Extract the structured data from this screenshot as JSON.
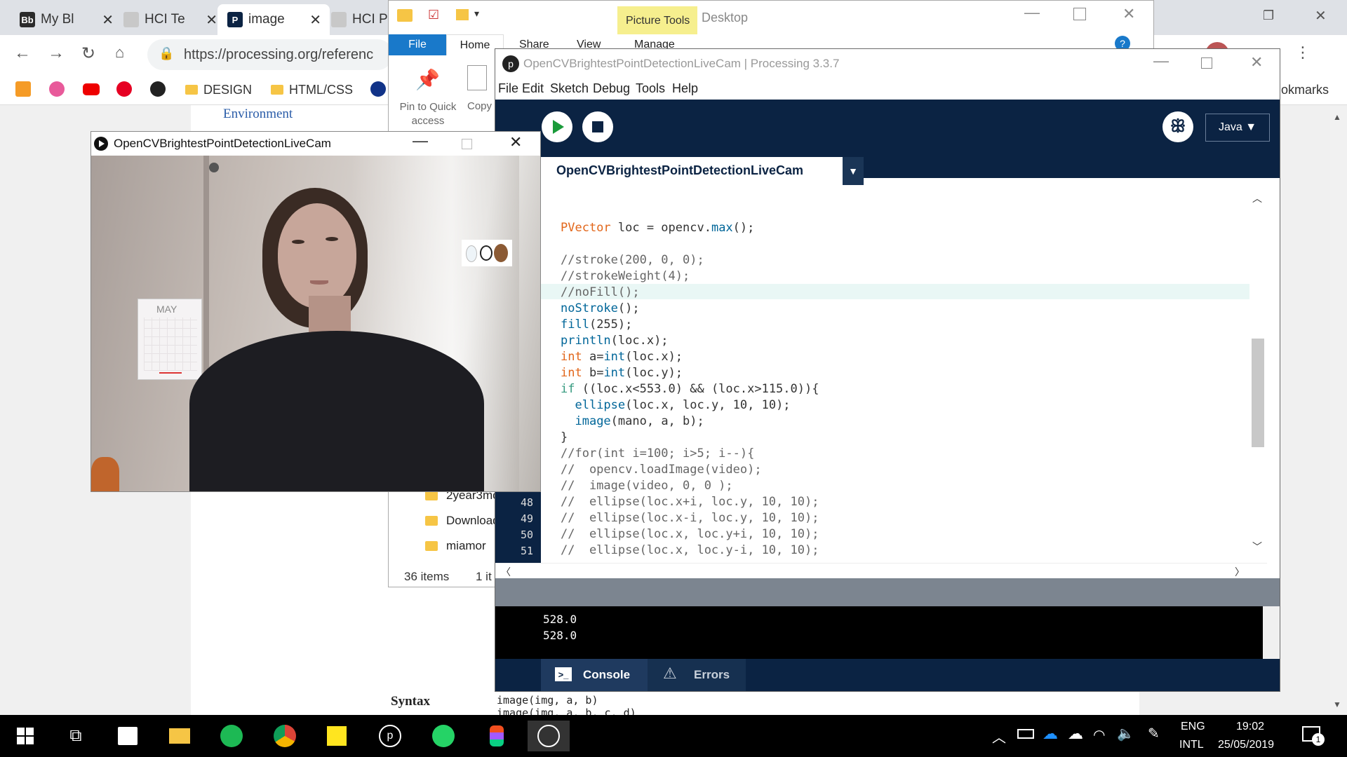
{
  "chrome": {
    "tabs": [
      {
        "label": "My Bl",
        "favicon": "Bb"
      },
      {
        "label": "HCI Te",
        "favicon": ""
      },
      {
        "label": "image",
        "favicon": "P"
      },
      {
        "label": "HCI P",
        "favicon": ""
      }
    ],
    "url": "https://processing.org/referenc",
    "bookmarks": [
      "DESIGN",
      "HTML/CSS"
    ],
    "bookmarks_right": "okmarks"
  },
  "page": {
    "environment_link": "Environment",
    "syntax_label": "Syntax",
    "syntax_lines": [
      "image(img, a, b)",
      "image(img, a, b, c, d)"
    ]
  },
  "explorer": {
    "tab_file": "File",
    "tab_home": "Home",
    "tab_share": "Share",
    "tab_view": "View",
    "tab_manage": "Manage",
    "picture_tools": "Picture Tools",
    "title": "Desktop",
    "pin_label": "Pin to Quick access",
    "copy_label": "Copy",
    "items": [
      "2year3mo",
      "Download",
      "miamor"
    ],
    "status_items": "36 items",
    "status_selected": "1 it"
  },
  "processing": {
    "title": "OpenCVBrightestPointDetectionLiveCam | Processing 3.3.7",
    "menu": [
      "File",
      "Edit",
      "Sketch",
      "Debug",
      "Tools",
      "Help"
    ],
    "mode": "Java ▼",
    "sketch_tab": "OpenCVBrightestPointDetectionLiveCam",
    "line_numbers": [
      "48",
      "49",
      "50",
      "51"
    ],
    "console_lines": [
      "528.0",
      "528.0"
    ],
    "console_tab": "Console",
    "errors_tab": "Errors"
  },
  "cam_window": {
    "title": "OpenCVBrightestPointDetectionLiveCam",
    "calendar_label": "MAY"
  },
  "taskbar": {
    "lang_top": "ENG",
    "lang_bottom": "INTL",
    "time": "19:02",
    "date": "25/05/2019",
    "notifications": "1"
  },
  "colors": {
    "processing_navy": "#0b2343",
    "keyword_orange": "#e2661a",
    "function_blue": "#006699"
  }
}
